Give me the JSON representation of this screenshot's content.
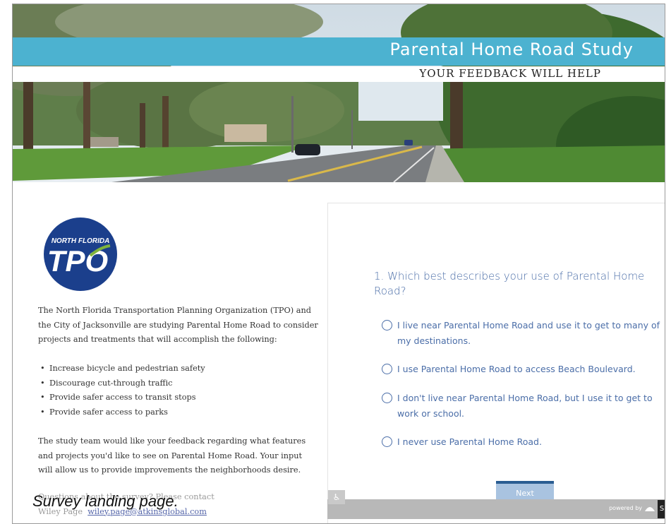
{
  "banner": {
    "title": "Parental Home Road Study",
    "subtitle": "YOUR FEEDBACK WILL HELP"
  },
  "logo": {
    "top_text": "NORTH FLORIDA",
    "main_text": "TPO",
    "colors": {
      "circle": "#1b3f8c",
      "accent": "#7fb43c"
    }
  },
  "intro": {
    "paragraph": "The North Florida Transportation Planning Organization (TPO) and the City of Jacksonville are studying Parental Home Road to consider projects and treatments that will accomplish the following:",
    "bullets": [
      "Increase bicycle and pedestrian safety",
      "Discourage cut-through traffic",
      "Provide safer access to transit stops",
      "Provide safer access to parks"
    ],
    "closing": "The study team would like your feedback regarding what features and projects you'd like to see on Parental Home Road. Your input will allow us to provide improvements the neighborhoods desire.",
    "contact_prefix": "Questions about the survey? Please contact",
    "contact_name": "Wiley Page",
    "contact_email": "wiley.page@atkinsglobal.com"
  },
  "survey": {
    "question": "1. Which best describes your use of Parental Home Road?",
    "options": [
      "I live near Parental Home Road and use it to get to many of my destinations.",
      "I use Parental Home Road to access Beach Boulevard.",
      "I don't live near Parental Home Road, but I use it to get to work or school.",
      "I never use Parental Home Road."
    ],
    "next_label": "Next",
    "powered_by": "powered by",
    "brand_letter": "S",
    "colors": {
      "text": "#4b6ea8",
      "button": "#a9c3e0",
      "button_top": "#2a5d92"
    }
  },
  "caption": "Survey landing page."
}
